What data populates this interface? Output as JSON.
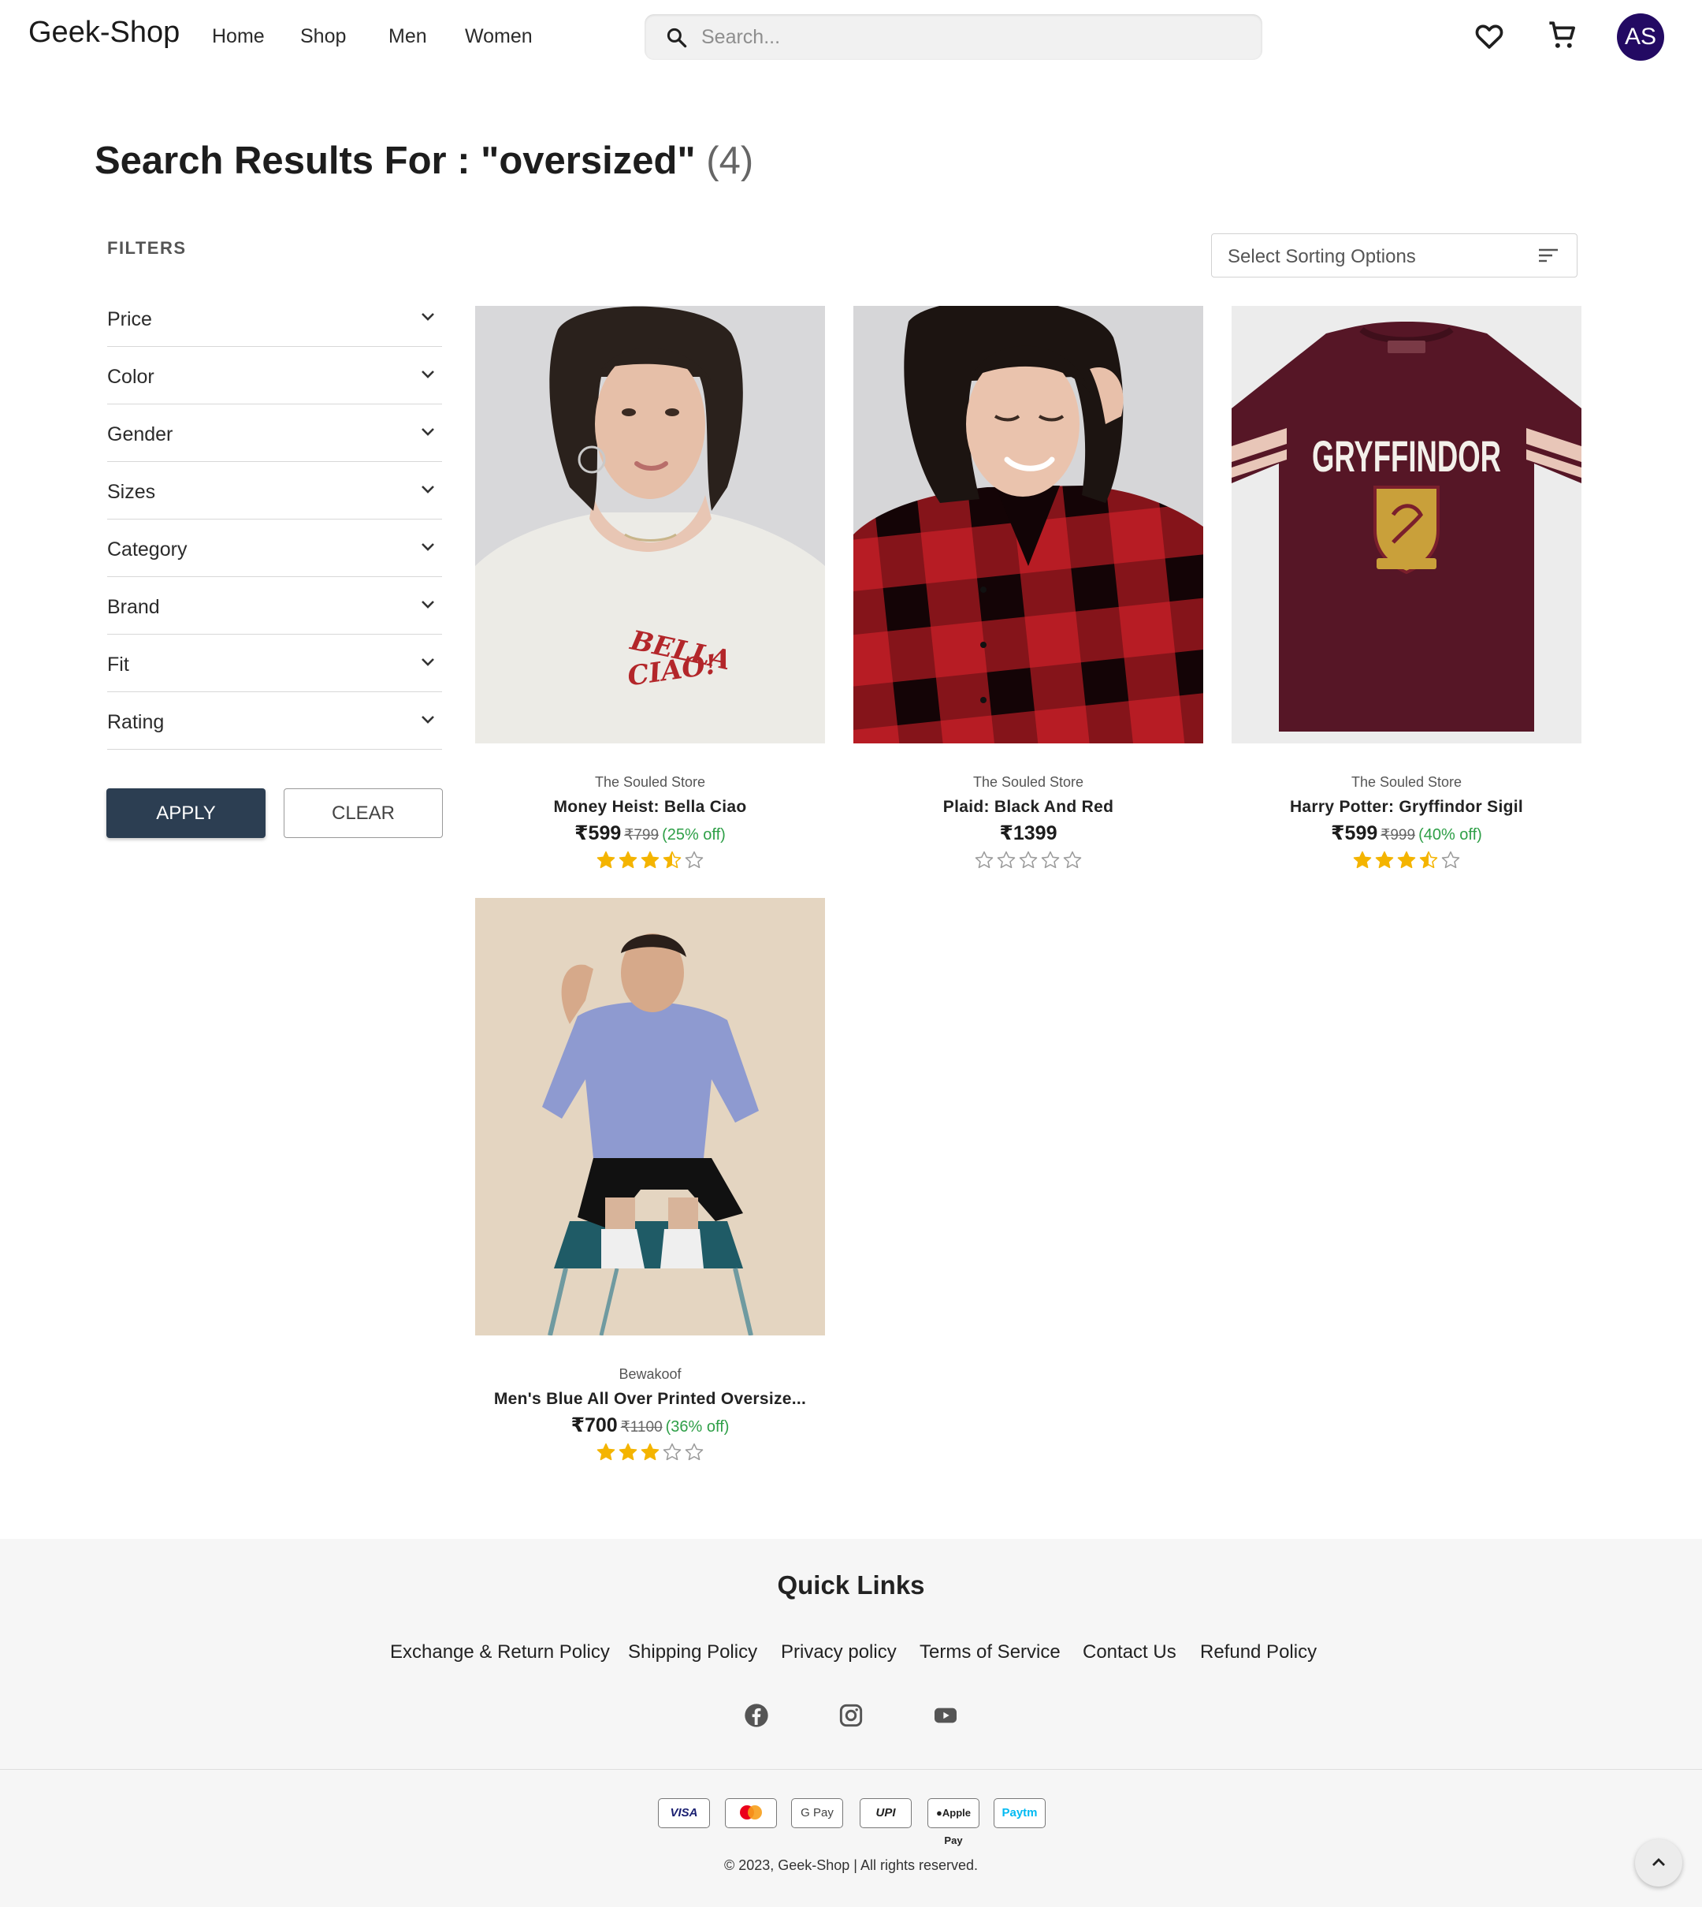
{
  "header": {
    "logo": "Geek-Shop",
    "nav": [
      "Home",
      "Shop",
      "Men",
      "Women"
    ],
    "search_placeholder": "Search...",
    "avatar_initials": "AS",
    "avatar_color": "#230a63"
  },
  "page": {
    "title": "Search Results For : \"oversized\"",
    "count": "(4)"
  },
  "filters": {
    "label": "FILTERS",
    "items": [
      "Price",
      "Color",
      "Gender",
      "Sizes",
      "Category",
      "Brand",
      "Fit",
      "Rating"
    ],
    "apply_label": "APPLY",
    "clear_label": "CLEAR"
  },
  "sort": {
    "placeholder": "Select Sorting Options"
  },
  "products": [
    {
      "brand": "The Souled Store",
      "name": "Money Heist: Bella Ciao",
      "price": "₹599",
      "mrp": "₹799",
      "discount": "(25% off)",
      "rating": 3.5,
      "image_text": "BELLA CIAO!"
    },
    {
      "brand": "The Souled Store",
      "name": "Plaid: Black And Red",
      "price": "₹1399",
      "mrp": "",
      "discount": "",
      "rating": 0
    },
    {
      "brand": "The Souled Store",
      "name": "Harry Potter: Gryffindor Sigil",
      "price": "₹599",
      "mrp": "₹999",
      "discount": "(40% off)",
      "rating": 3.5,
      "image_text": "GRYFFINDOR"
    },
    {
      "brand": "Bewakoof",
      "name": "Men's Blue All Over Printed Oversize...",
      "price": "₹700",
      "mrp": "₹1100",
      "discount": "(36% off)",
      "rating": 3
    }
  ],
  "footer": {
    "quick_links_title": "Quick Links",
    "links": [
      "Exchange & Return Policy",
      "Shipping Policy",
      "Privacy policy",
      "Terms of Service",
      "Contact Us",
      "Refund Policy"
    ],
    "social_icons": [
      "facebook-icon",
      "instagram-icon",
      "youtube-icon"
    ],
    "payment_methods": [
      "VISA",
      "Mastercard",
      "G Pay",
      "UPI",
      "Apple Pay",
      "Paytm"
    ],
    "copyright": "© 2023, Geek-Shop | All rights reserved."
  },
  "colors": {
    "star": "#f4b400",
    "star_empty": "#9a9a9a",
    "discount": "#2e9f47",
    "apply_button": "#2c3e52"
  }
}
